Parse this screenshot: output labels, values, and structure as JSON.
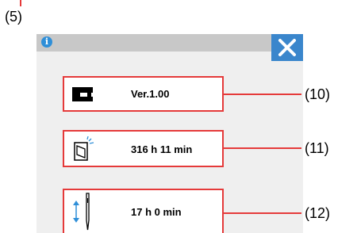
{
  "callouts": {
    "top": "(5)",
    "version": "(10)",
    "power_on_time": "(11)",
    "needle_time": "(12)"
  },
  "topbar": {
    "info_icon_glyph": "i",
    "close_icon": "close-icon"
  },
  "rows": [
    {
      "icon": "sewing-machine-icon",
      "value": "Ver.1.00"
    },
    {
      "icon": "power-switch-icon",
      "value": "316 h 11 min"
    },
    {
      "icon": "needle-icon",
      "value": "17 h 0 min"
    }
  ],
  "colors": {
    "accent_blue": "#3a86cc",
    "callout_red": "#e53a3a",
    "panel_bg": "#efefef",
    "bar_bg": "#c8c8c8"
  }
}
